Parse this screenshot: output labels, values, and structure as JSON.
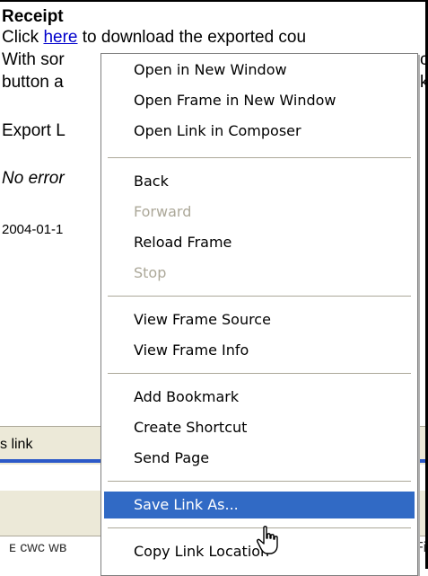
{
  "page": {
    "heading": "Receipt",
    "click_prefix": "Click ",
    "click_link": "here",
    "click_suffix": " to download the exported cou",
    "with_text": "With sor",
    "with_tail": "c",
    "button_text": "button a",
    "button_tail": "k",
    "export_text": "Export L",
    "noerror_text": "No error",
    "date_text": "2004-01-1"
  },
  "statusbar": {
    "text": "s link"
  },
  "background": {
    "cut_left": "ᴇ сwс wв",
    "cut_right": "Fi"
  },
  "menu": {
    "items": [
      {
        "label": "Open in New Window",
        "enabled": true
      },
      {
        "label": "Open Frame in New Window",
        "enabled": true
      },
      {
        "label": "Open Link in Composer",
        "enabled": true
      },
      {
        "label": "Back",
        "enabled": true
      },
      {
        "label": "Forward",
        "enabled": false
      },
      {
        "label": "Reload Frame",
        "enabled": true
      },
      {
        "label": "Stop",
        "enabled": false
      },
      {
        "label": "View Frame Source",
        "enabled": true
      },
      {
        "label": "View Frame Info",
        "enabled": true
      },
      {
        "label": "Add Bookmark",
        "enabled": true
      },
      {
        "label": "Create Shortcut",
        "enabled": true
      },
      {
        "label": "Send Page",
        "enabled": true
      },
      {
        "label": "Save Link As...",
        "enabled": true,
        "highlighted": true
      },
      {
        "label": "Copy Link Location",
        "enabled": true
      }
    ]
  },
  "colors": {
    "highlight": "#316ac5",
    "disabled_text": "#aca899",
    "link": "#0000cc",
    "chrome": "#ece9d8"
  },
  "cursor": {
    "icon": "hand-pointer-icon"
  }
}
